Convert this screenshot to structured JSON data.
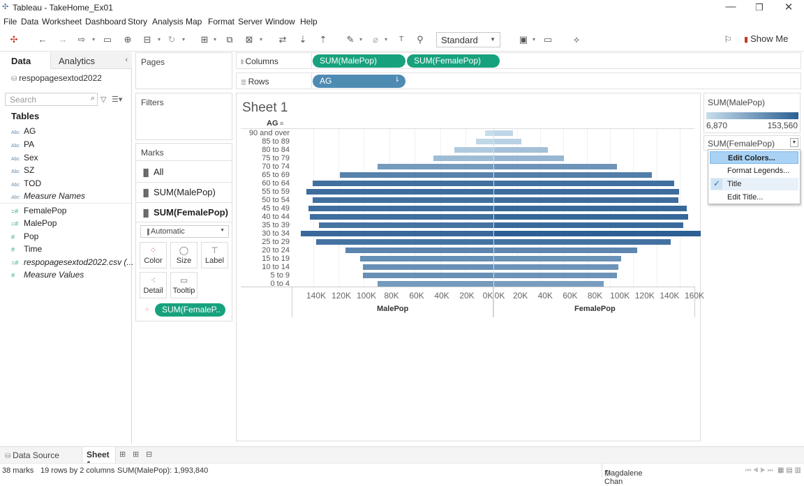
{
  "window": {
    "title": "Tableau - TakeHome_Ex01",
    "minimize": "—",
    "restore": "❐",
    "close": "✕"
  },
  "menu": [
    "File",
    "Data",
    "Worksheet",
    "Dashboard",
    "Story",
    "Analysis",
    "Map",
    "Format",
    "Server",
    "Window",
    "Help"
  ],
  "toolbar": {
    "fit_value": "Standard",
    "show_me": "Show Me"
  },
  "left_pane": {
    "tab_data": "Data",
    "tab_analytics": "Analytics",
    "collapse": "‹",
    "data_source": "respopagesextod2022",
    "search_placeholder": "Search",
    "tables_heading": "Tables",
    "dimensions": [
      "AG",
      "PA",
      "Sex",
      "SZ",
      "TOD"
    ],
    "dimension_italic": "Measure Names",
    "dim_icon": "Abc",
    "measures": [
      "FemalePop",
      "MalePop",
      "Pop",
      "Time"
    ],
    "measure_italic": [
      "respopagesextod2022.csv (...",
      "Measure Values"
    ]
  },
  "pages_card": {
    "title": "Pages"
  },
  "filters_card": {
    "title": "Filters"
  },
  "marks_card": {
    "title": "Marks",
    "all": "All",
    "row1": "SUM(MalePop)",
    "row2": "SUM(FemalePop)",
    "mark_type": "Automatic",
    "color": "Color",
    "size": "Size",
    "label": "Label",
    "detail": "Detail",
    "tooltip": "Tooltip",
    "color_pill": "SUM(FemaleP.."
  },
  "shelves": {
    "columns_label": "Columns",
    "rows_label": "Rows",
    "columns_pills": [
      "SUM(MalePop)",
      "SUM(FemalePop)"
    ],
    "rows_pill": "AG"
  },
  "sheet": {
    "title": "Sheet 1",
    "row_header": "AG",
    "left_axis_title": "MalePop",
    "right_axis_title": "FemalePop",
    "left_ticks": [
      "140K",
      "120K",
      "100K",
      "80K",
      "60K",
      "40K",
      "20K",
      "0K"
    ],
    "right_ticks": [
      "0K",
      "20K",
      "40K",
      "60K",
      "80K",
      "100K",
      "120K",
      "140K",
      "160K"
    ]
  },
  "legend_male": {
    "title": "SUM(MalePop)",
    "min": "6,870",
    "max": "153,560"
  },
  "legend_female": {
    "title": "SUM(FemalePop)"
  },
  "context_menu": {
    "items": [
      "Edit Colors...",
      "Format Legends...",
      "Title",
      "Edit Title..."
    ],
    "checked_mark": "✓"
  },
  "bottom_tabs": {
    "data_source": "Data Source",
    "sheet": "Sheet 1"
  },
  "status": {
    "marks": "38 marks",
    "rows": "19 rows by 2 columns",
    "sum": "SUM(MalePop): 1,993,840",
    "user": "Magdalene Chan"
  },
  "colors": {
    "accent_green": "#17a27d",
    "pill_blue": "#4e8bb3",
    "bar_dark": "#2c5f93",
    "bar_light": "#a8cbe3"
  },
  "chart_data": {
    "type": "bar",
    "categories": [
      "90 and over",
      "85 to 89",
      "80 to 84",
      "75 to 79",
      "70 to 74",
      "65 to 69",
      "60 to 64",
      "55 to 59",
      "50 to 54",
      "45 to 49",
      "40 to 44",
      "35 to 39",
      "30 to 34",
      "25 to 29",
      "20 to 24",
      "15 to 19",
      "10 to 14",
      "5 to 9",
      "0 to 4"
    ],
    "series": [
      {
        "name": "MalePop",
        "values": [
          6870,
          14000,
          31000,
          48000,
          92000,
          122000,
          144000,
          149000,
          144000,
          147000,
          146000,
          139000,
          153560,
          141000,
          118000,
          106000,
          104000,
          104000,
          92000
        ]
      },
      {
        "name": "FemalePop",
        "values": [
          15000,
          22000,
          43000,
          56000,
          99000,
          127000,
          145000,
          149000,
          148000,
          155000,
          156000,
          152000,
          166000,
          142000,
          115000,
          102000,
          100000,
          99000,
          88000
        ]
      }
    ],
    "xlabel_left": "MalePop",
    "xlabel_right": "FemalePop",
    "xlim": [
      0,
      160000
    ]
  }
}
